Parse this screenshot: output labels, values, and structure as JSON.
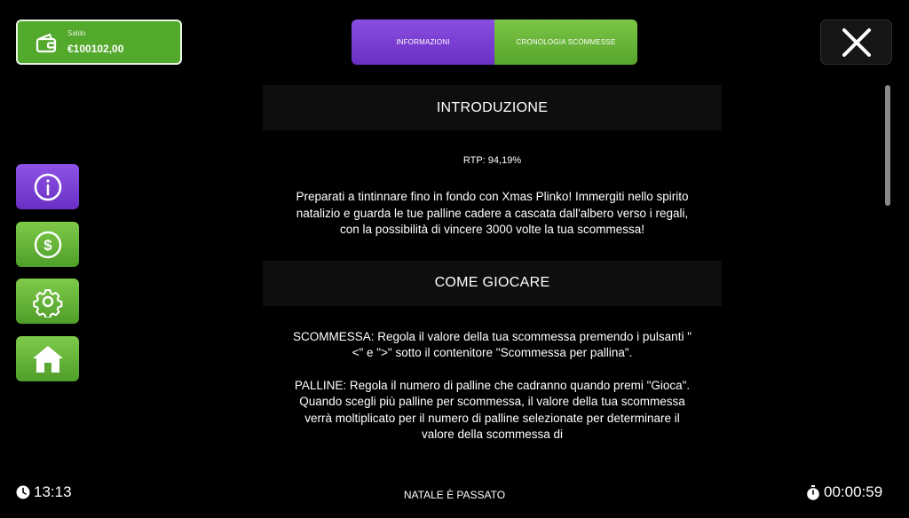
{
  "balance": {
    "label": "Saldo",
    "value": "€100102,00",
    "icon": "wallet-icon"
  },
  "tabs": [
    {
      "label": "INFORMAZIONI",
      "active": true
    },
    {
      "label": "CRONOLOGIA SCOMMESSE",
      "active": false
    }
  ],
  "close": {
    "icon": "close-icon"
  },
  "sidebar": [
    {
      "icon": "info-icon"
    },
    {
      "icon": "dollar-coin-icon"
    },
    {
      "icon": "gear-icon"
    },
    {
      "icon": "home-icon"
    }
  ],
  "sections": {
    "intro_title": "INTRODUZIONE",
    "rtp": "RTP: 94,19%",
    "intro_text": "Preparati a tintinnare fino in fondo con Xmas Plinko! Immergiti nello spirito natalizio e guarda le tue palline cadere a cascata dall'albero verso i regali, con la possibilità di vincere 3000 volte la tua scommessa!",
    "howto_title": "COME GIOCARE",
    "bet_text": "SCOMMESSA: Regola il valore della tua scommessa premendo i pulsanti \"<\" e \">\" sotto il contenitore \"Scommessa per pallina\".",
    "balls_text": "PALLINE: Regola il numero di palline che cadranno quando premi \"Gioca\". Quando scegli più palline per scommessa, il valore della tua scommessa verrà moltiplicato per il numero di palline selezionate per determinare il valore della scommessa di"
  },
  "footer": {
    "time": "13:13",
    "title": "NATALE È PASSATO",
    "elapsed": "00:00:59"
  },
  "colors": {
    "green": "#53a92c",
    "purple": "#7a3fd6",
    "background": "#000000"
  }
}
